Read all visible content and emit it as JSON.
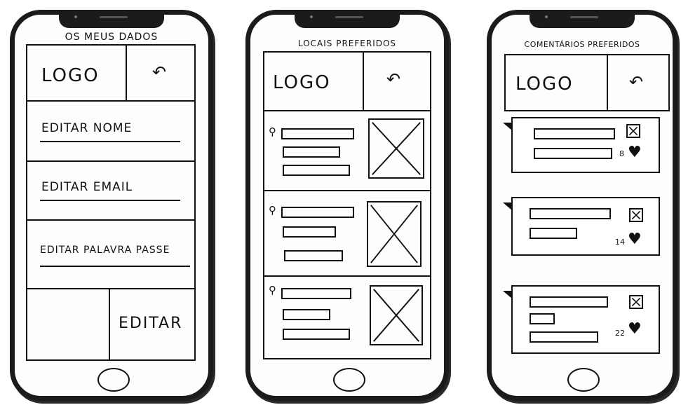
{
  "screens": [
    {
      "title": "OS MEUS DADOS",
      "logo": "LOGO",
      "menu": [
        "EDITAR NOME",
        "EDITAR EMAIL",
        "EDITAR PALAVRA PASSE"
      ],
      "edit_button": "EDITAR"
    },
    {
      "title": "LOCAIS PREFERIDOS",
      "logo": "LOGO"
    },
    {
      "title": "COMENTÁRIOS PREFERIDOS",
      "logo": "LOGO",
      "likes": [
        "8",
        "14",
        "22"
      ]
    }
  ],
  "icons": {
    "back": "↶",
    "pin": "⚲",
    "heart": "♥"
  },
  "colors": {
    "ink": "#111111",
    "paper": "#ffffff",
    "frame": "#1b1b1b"
  }
}
